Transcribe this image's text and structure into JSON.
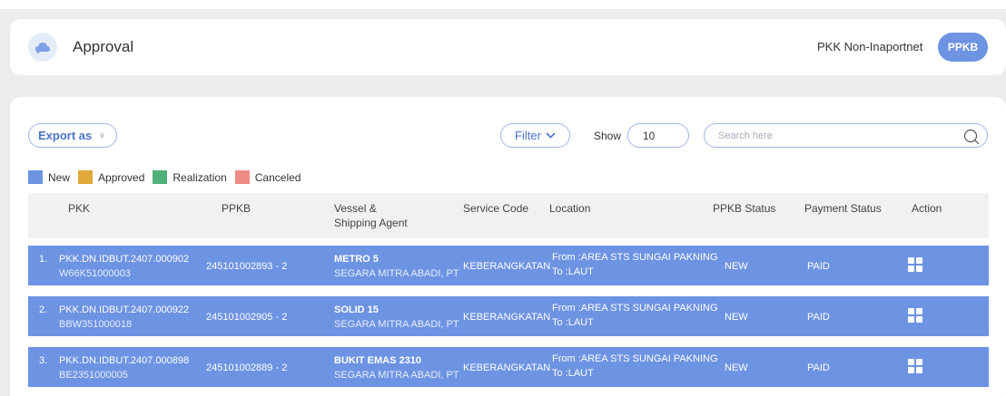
{
  "header": {
    "title": "Approval",
    "pkk_non_label": "PKK Non-Inaportnet",
    "ppkb_button": "PPKB",
    "icon": "cloud-icon"
  },
  "toolbar": {
    "export_label": "Export as",
    "filter_label": "Filter",
    "show_label": "Show",
    "show_value": "10",
    "search_placeholder": "Search here"
  },
  "legend": [
    {
      "label": "New",
      "color": "#6d93e3"
    },
    {
      "label": "Approved",
      "color": "#e0a83a"
    },
    {
      "label": "Realization",
      "color": "#4fb07a"
    },
    {
      "label": "Canceled",
      "color": "#ee8a86"
    }
  ],
  "table": {
    "columns": {
      "pkk": "PKK",
      "ppkb": "PPKB",
      "vessel_line1": "Vessel &",
      "vessel_line2": "Shipping Agent",
      "service": "Service Code",
      "location": "Location",
      "ppkb_status": "PPKB Status",
      "payment": "Payment Status",
      "action": "Action"
    },
    "rows": [
      {
        "num": "1.",
        "pkk": "PKK.DN.IDBUT.2407.000902",
        "pkk_sub": "W66K51000003",
        "ppkb": "245101002893 - 2",
        "vessel": "METRO 5",
        "agent": "SEGARA MITRA ABADI, PT",
        "service": "KEBERANGKATAN",
        "loc_from": "From :AREA STS SUNGAI PAKNING",
        "loc_to": "To :LAUT",
        "ppkb_status": "NEW",
        "payment": "PAID"
      },
      {
        "num": "2.",
        "pkk": "PKK.DN.IDBUT.2407.000922",
        "pkk_sub": "BBW351000018",
        "ppkb": "245101002905 - 2",
        "vessel": "SOLID 15",
        "agent": "SEGARA MITRA ABADI, PT",
        "service": "KEBERANGKATAN",
        "loc_from": "From :AREA STS SUNGAI PAKNING",
        "loc_to": "To :LAUT",
        "ppkb_status": "NEW",
        "payment": "PAID"
      },
      {
        "num": "3.",
        "pkk": "PKK.DN.IDBUT.2407.000898",
        "pkk_sub": "BE2351000005",
        "ppkb": "245101002889 - 2",
        "vessel": "BUKIT EMAS 2310",
        "agent": "SEGARA MITRA ABADI, PT",
        "service": "KEBERANGKATAN",
        "loc_from": "From :AREA STS SUNGAI PAKNING",
        "loc_to": "To :LAUT",
        "ppkb_status": "NEW",
        "payment": "PAID"
      }
    ]
  }
}
